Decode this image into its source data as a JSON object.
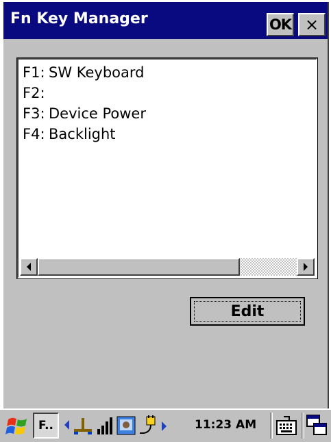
{
  "window": {
    "title": "Fn Key Manager",
    "ok_label": "OK",
    "close_label": "×"
  },
  "function_keys": [
    {
      "key": "F1:",
      "action": "SW Keyboard"
    },
    {
      "key": "F2:",
      "action": ""
    },
    {
      "key": "F3:",
      "action": "Device Power"
    },
    {
      "key": "F4:",
      "action": "Backlight"
    }
  ],
  "edit_button": {
    "label": "Edit"
  },
  "taskbar": {
    "task_label": "F..",
    "clock": "11:23 AM",
    "icons": [
      "start-flag-icon",
      "network-icon",
      "signal-bars-icon",
      "wireless-app-icon",
      "power-plug-icon",
      "keyboard-icon",
      "switch-windows-icon"
    ]
  },
  "colors": {
    "title_bar": "#0a0a80",
    "face": "#c0c0c0",
    "list_bg": "#ffffff"
  }
}
